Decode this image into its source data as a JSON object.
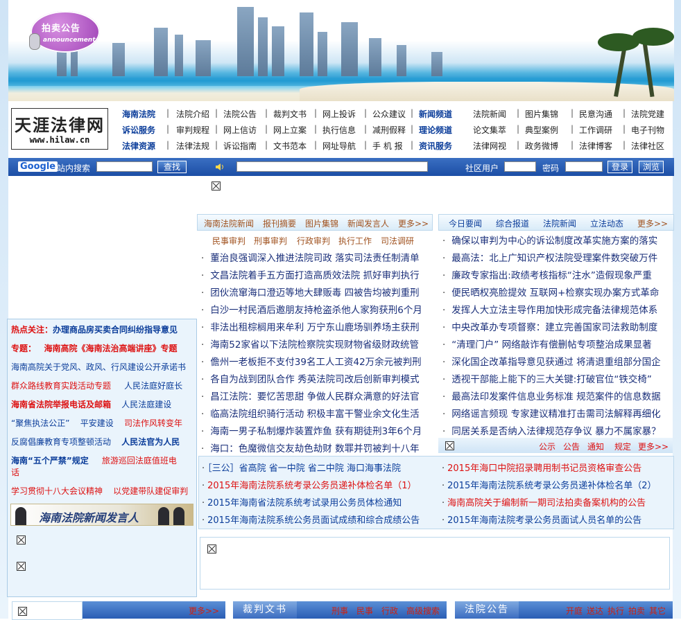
{
  "banner": {
    "badge_title": "拍卖公告",
    "badge_sub": "announcement"
  },
  "logo": {
    "name": "天涯法律网",
    "url": "www.hilaw.cn"
  },
  "nav": {
    "row1": [
      "海南法院",
      "法院介绍",
      "法院公告",
      "裁判文书",
      "网上投诉",
      "公众建议",
      "新闻频道",
      "法院新闻",
      "图片集锦",
      "民意沟通",
      "法院党建"
    ],
    "row2": [
      "诉讼服务",
      "审判规程",
      "网上信访",
      "网上立案",
      "执行信息",
      "减刑假释",
      "理论频道",
      "论文集萃",
      "典型案例",
      "工作调研",
      "电子刊物"
    ],
    "row3": [
      "法律资源",
      "法律法规",
      "诉讼指南",
      "文书范本",
      "网址导航",
      "手 机 报",
      "资讯服务",
      "法律网视",
      "政务微博",
      "法律博客",
      "法律社区"
    ]
  },
  "search": {
    "google": "Google",
    "site_label": "站内搜索",
    "search_button": "查找",
    "user_label": "社区用户",
    "password_label": "密码",
    "login_button": "登录",
    "browse_button": "浏览"
  },
  "left": {
    "hot_prefix": "热点关注：",
    "hot_text": "办理商品房买卖合同纠纷指导意见",
    "topic_prefix": "专题：",
    "topic_text": "海南高院《海南法治高端讲座》专题",
    "line3": "海南高院关于党风、政风、行风建设公开承诺书",
    "line4a": "群众路线教育实践活动专题",
    "line4b": "人民法庭好庭长",
    "line5a": "海南省法院举报电话及邮箱",
    "line5b": "人民法庭建设",
    "line6a": "“聚焦执法公正”",
    "line6b": "平安建设",
    "line6c": "司法作风转变年",
    "line7a": "反腐倡廉教育专项整顿活动",
    "line7b": "人民法官为人民",
    "line8a": "海南“五个严禁”规定",
    "line8b": "旅游巡回法庭值班电",
    "line8c": "话",
    "line9a": "学习贯彻十八大会议精神",
    "line9b": "以党建带队建促审判",
    "speaker_banner": "海南法院新闻发言人"
  },
  "center_tabs": [
    "海南法院新闻",
    "报刊摘要",
    "图片集锦",
    "新闻发言人",
    "更多>>"
  ],
  "center_subtabs": [
    "民事审判",
    "刑事审判",
    "行政审判",
    "执行工作",
    "司法调研"
  ],
  "center_news": [
    "董治良强调深入推进法院司政 落实司法责任制清单",
    "文昌法院着手五方面打造高质效法院 抓好审判执行",
    "团伙流窜海口澄迈等地大肆贩毒 四被告均被判重刑",
    "白沙一村民酒后邀朋友持枪盗杀他人家狗获刑6个月",
    "非法出租棕榈用来牟利 万宁东山鹿场驯养场主获刑",
    "海南52家省以下法院检察院实现财物省级财政统管",
    "儋州一老板拒不支付39名工人工资42万余元被判刑",
    "各自为战到团队合作 秀英法院司改后创新审判模式",
    "昌江法院：要忆苦思甜 争做人民群众满意的好法官",
    "临高法院组织骑行活动 积极丰富干警业余文化生活",
    "海南一男子私制爆炸装置炸鱼 获有期徒刑3年6个月",
    "海口：色魔微信交友劫色劫财 数罪并罚被判十八年"
  ],
  "right_tabs": [
    "今日要闻",
    "综合报道",
    "法院新闻",
    "立法动态",
    "更多>>"
  ],
  "right_news": [
    "确保以审判为中心的诉讼制度改革实施方案的落实",
    "最高法：北上广知识产权法院受理案件数突破万件",
    "廉政专家指出:政绩考核指标“注水”造假现象严重",
    "便民晒权亮脸提效 互联网+检察实现办案方式革命",
    "发挥人大立法主导作用加快形成完备法律规范体系",
    "中央改革办专项督察：建立完善国家司法救助制度",
    "“清理门户” 网络敲诈有偿删帖专项整治成果显著",
    "深化国企改革指导意见获通过 将清退重组部分国企",
    "透视干部能上能下的三大关键:打破官位“铁交椅”",
    "最高法印发案件信息业务标准 规范案件的信息数据",
    "网络谣言频现 专家建议精准打击需司法解释再细化",
    "同居关系是否纳入法律规范存争议 暴力不属家暴？"
  ],
  "pub_tabs": [
    "公示",
    "公告",
    "通知",
    "规定",
    "更多>>"
  ],
  "notices_left": [
    "［三公］省高院  省一中院  省二中院  海口海事法院",
    "2015年海南法院系统考录公务员递补体检名单（1）",
    "2015年海南省法院系统考试录用公务员体检通知",
    "2015年海南法院系统公务员面试成绩和综合成绩公告"
  ],
  "notices_right": [
    "2015年海口中院招录聘用制书记员资格审查公告",
    "2015年海南法院系统考录公务员递补体检名单（2）",
    "海南高院关于编制新一期司法拍卖备案机构的公告",
    "2015年海南法院考录公务员面试人员名单的公告"
  ],
  "bottom": {
    "more": "更多>>",
    "docs_title": "裁判文书",
    "docs_links": [
      "刑事",
      "民事",
      "行政",
      "高级搜索"
    ],
    "court_title": "法院公告",
    "court_links": [
      "开庭",
      "送达",
      "执行",
      "拍卖",
      "其它"
    ]
  },
  "colors": {
    "nav_blue": "#0b3d9a",
    "news_blue": "#1a2f7a",
    "accent_red": "#d11",
    "bar_blue": "#1c4ea5"
  }
}
